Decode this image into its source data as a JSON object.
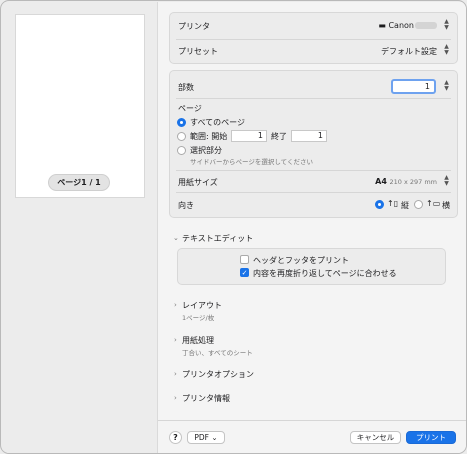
{
  "sidebar": {
    "page_indicator": "ページ1 / 1"
  },
  "printer": {
    "label": "プリンタ",
    "value": "Canon"
  },
  "preset": {
    "label": "プリセット",
    "value": "デフォルト設定"
  },
  "copies": {
    "label": "部数",
    "value": "1"
  },
  "pages": {
    "label": "ページ",
    "all_label": "すべてのページ",
    "range_label": "範囲: 開始",
    "range_from": "1",
    "range_to_label": "終了",
    "range_to": "1",
    "selection_label": "選択部分",
    "selection_hint": "サイドバーからページを選択してください"
  },
  "paper_size": {
    "label": "用紙サイズ",
    "value": "A4",
    "dims": "210 x 297 mm"
  },
  "orientation": {
    "label": "向き",
    "portrait": "縦",
    "landscape": "横",
    "selected": "portrait"
  },
  "text_edit": {
    "title": "テキストエディット",
    "header_footer": "ヘッダとフッタをプリント",
    "header_footer_checked": false,
    "rewrap": "内容を再度折り返してページに合わせる",
    "rewrap_checked": true
  },
  "layout": {
    "title": "レイアウト",
    "summary": "1ページ/枚"
  },
  "paper_handling": {
    "title": "用紙処理",
    "summary": "丁合い、すべてのシート"
  },
  "printer_options": {
    "title": "プリンタオプション"
  },
  "printer_info": {
    "title": "プリンタ情報"
  },
  "footer": {
    "help": "?",
    "pdf": "PDF",
    "cancel": "キャンセル",
    "print": "プリント"
  },
  "colors": {
    "accent": "#1a73e8"
  }
}
